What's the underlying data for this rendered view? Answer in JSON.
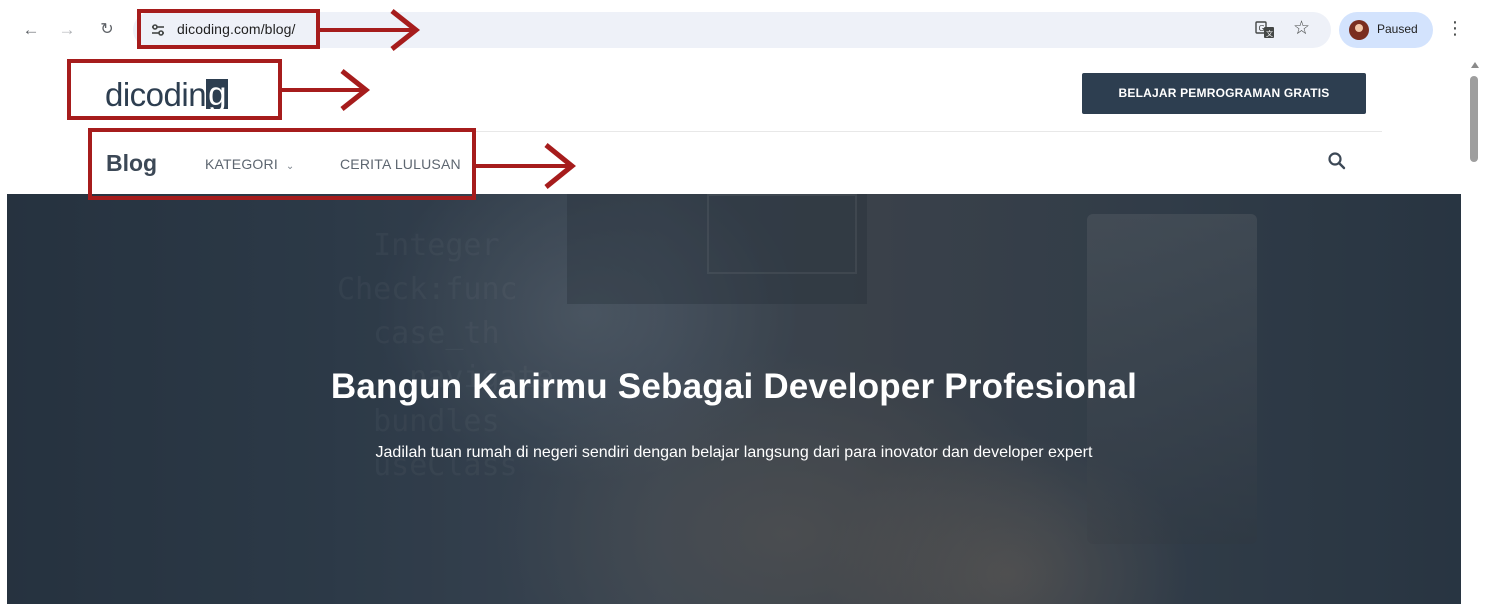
{
  "browser": {
    "url": "dicoding.com/blog/",
    "profile_label": "Paused",
    "icons": {
      "back": "arrow-left-icon",
      "forward": "arrow-right-icon",
      "reload": "reload-icon",
      "site_info": "site-settings-icon",
      "translate": "translate-icon",
      "bookmark": "star-icon",
      "menu": "kebab-menu-icon"
    }
  },
  "header": {
    "logo_text_main": "dicodin",
    "logo_text_box": "g",
    "cta_label": "BELAJAR PEMROGRAMAN GRATIS",
    "colors": {
      "brand": "#2d3e50"
    }
  },
  "nav": {
    "title": "Blog",
    "items": [
      {
        "label": "KATEGORI",
        "has_dropdown": true
      },
      {
        "label": "CERITA LULUSAN",
        "has_dropdown": false
      }
    ],
    "search_icon": "search-icon"
  },
  "hero": {
    "title": "Bangun Karirmu Sebagai Developer Profesional",
    "subtitle": "Jadilah tuan rumah di negeri sendiri dengan belajar langsung dari para inovator dan developer expert"
  },
  "annotations": {
    "color": "#a61c1c"
  }
}
